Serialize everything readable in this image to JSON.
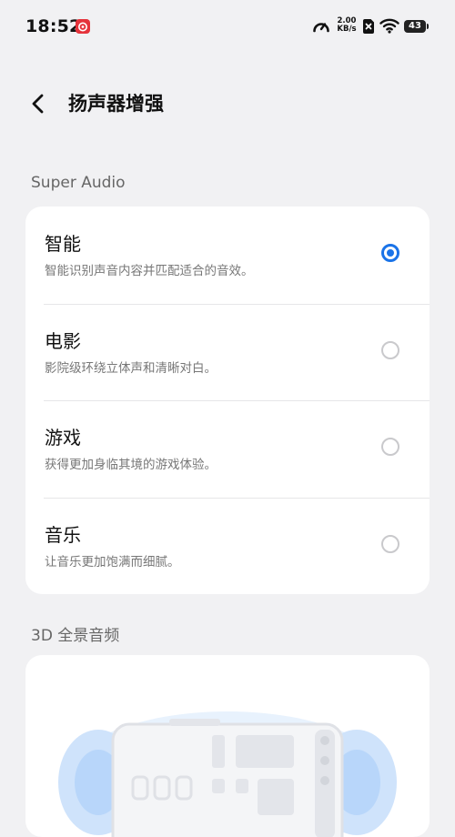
{
  "status_bar": {
    "time": "18:52",
    "net_speed_value": "2.00",
    "net_speed_unit": "KB/s",
    "battery_level": "43",
    "icons": [
      "netease-music-icon",
      "speed-gauge-icon",
      "no-sim-icon",
      "wifi-icon",
      "battery-icon"
    ]
  },
  "header": {
    "title": "扬声器增强",
    "back_icon": "chevron-left-icon"
  },
  "super_audio": {
    "section_title": "Super Audio",
    "options": [
      {
        "title": "智能",
        "desc": "智能识别声音内容并匹配适合的音效。",
        "selected": true
      },
      {
        "title": "电影",
        "desc": "影院级环绕立体声和清晰对白。",
        "selected": false
      },
      {
        "title": "游戏",
        "desc": "获得更加身临其境的游戏体验。",
        "selected": false
      },
      {
        "title": "音乐",
        "desc": "让音乐更加饱满而细腻。",
        "selected": false
      }
    ]
  },
  "panorama": {
    "section_title": "3D 全景音频",
    "illustration": "phone-surround-sound-illustration"
  },
  "colors": {
    "accent": "#1a73e8",
    "background": "#f1f1f3",
    "card": "#ffffff"
  }
}
